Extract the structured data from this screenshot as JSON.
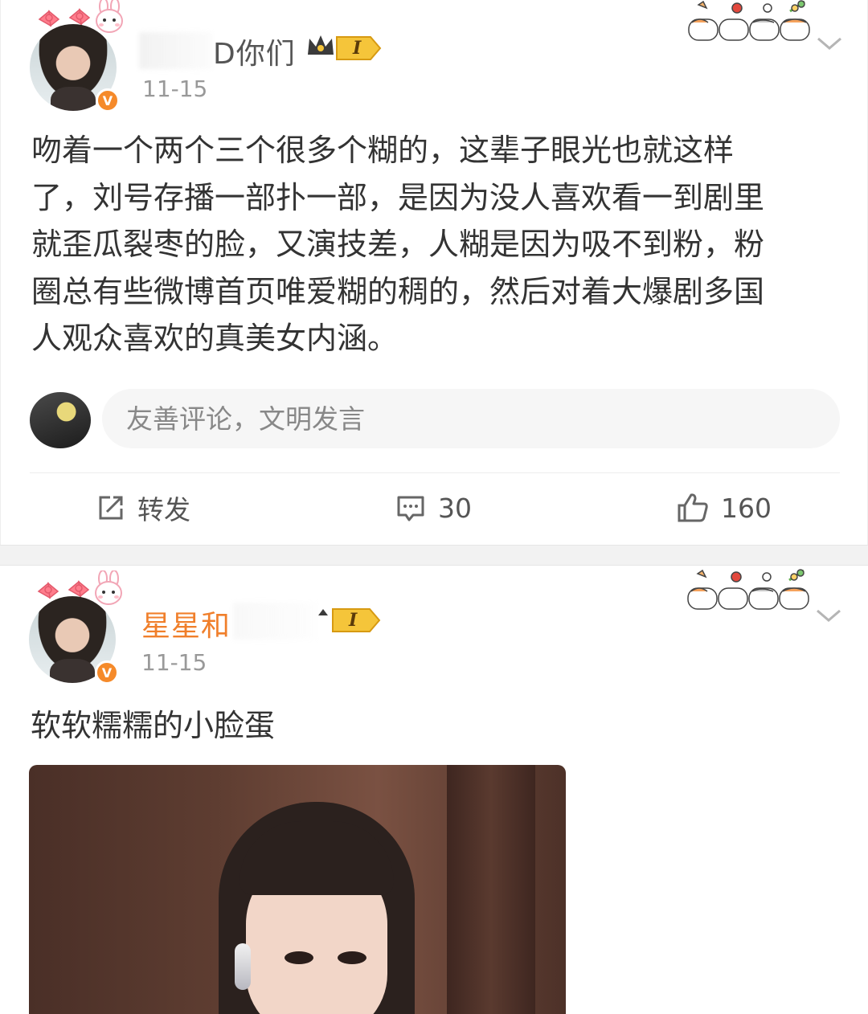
{
  "posts": [
    {
      "username_visible": "D你们",
      "level_badge": "I",
      "date": "11-15",
      "text": "吻着一个两个三个很多个糊的，这辈子眼光也就这样\n了，刘号存播一部扑一部，是因为没人喜欢看一到剧里\n就歪瓜裂枣的脸，又演技差，人糊是因为吸不到粉，粉\n圈总有些微博首页唯爱糊的稠的，然后对着大爆剧多国\n人观众喜欢的真美女内涵。",
      "verified_mark": "V",
      "comment_placeholder": "友善评论，文明发言",
      "actions": {
        "repost_label": "转发",
        "comment_count": "30",
        "like_count": "160"
      }
    },
    {
      "username_visible": "星星和",
      "level_badge": "I",
      "date": "11-15",
      "verified_mark": "V",
      "text": "软软糯糯的小脸蛋"
    }
  ],
  "colors": {
    "username_post1": "#555555",
    "username_post2": "#f07f2b",
    "date": "#999999",
    "verified": "#f58a2a",
    "crown": "#f5c53a"
  },
  "icons": {
    "repost": "external-share-icon",
    "comment": "speech-bubble-icon",
    "like": "thumbs-up-icon",
    "more": "chevron-down-icon",
    "level": "crown-badge-icon"
  }
}
